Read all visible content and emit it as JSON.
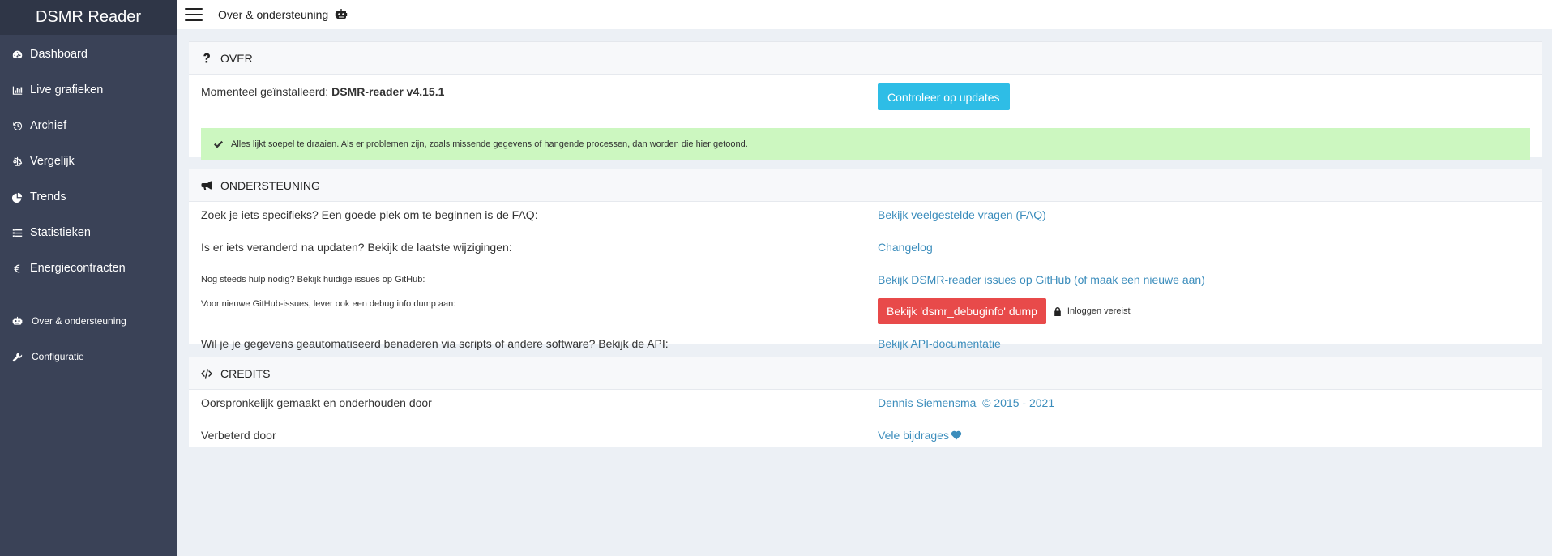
{
  "brand": "DSMR Reader",
  "sidebar": {
    "items": [
      {
        "label": "Dashboard",
        "icon": "tachometer-icon"
      },
      {
        "label": "Live grafieken",
        "icon": "bar-chart-icon"
      },
      {
        "label": "Archief",
        "icon": "history-icon"
      },
      {
        "label": "Vergelijk",
        "icon": "balance-scale-icon"
      },
      {
        "label": "Trends",
        "icon": "pie-chart-icon"
      },
      {
        "label": "Statistieken",
        "icon": "list-icon"
      },
      {
        "label": "Energiecontracten",
        "icon": "euro-icon"
      }
    ],
    "secondary": [
      {
        "label": "Over & ondersteuning",
        "icon": "robot-icon"
      },
      {
        "label": "Configuratie",
        "icon": "wrench-icon"
      }
    ]
  },
  "header": {
    "title": "Over & ondersteuning",
    "title_icon": "robot-icon"
  },
  "over": {
    "title": "OVER",
    "installed_label": "Momenteel geïnstalleerd: ",
    "installed_version": "DSMR-reader v4.15.1",
    "check_updates_button": "Controleer op updates",
    "alert_text": "Alles lijkt soepel te draaien. Als er problemen zijn, zoals missende gegevens of hangende processen, dan worden die hier getoond."
  },
  "support": {
    "title": "ONDERSTEUNING",
    "rows": [
      {
        "text": "Zoek je iets specifieks? Een goede plek om te beginnen is de FAQ:",
        "link": "Bekijk veelgestelde vragen (FAQ)"
      },
      {
        "text": "Is er iets veranderd na updaten? Bekijk de laatste wijzigingen:",
        "link": "Changelog"
      },
      {
        "text": "Nog steeds hulp nodig? Bekijk huidige issues op GitHub:",
        "link": "Bekijk DSMR-reader issues op GitHub (of maak een nieuwe aan)"
      },
      {
        "text": "Voor nieuwe GitHub-issues, lever ook een debug info dump aan:",
        "button": "Bekijk 'dsmr_debuginfo' dump",
        "lock_note": "Inloggen vereist"
      },
      {
        "text": "Wil je je gegevens geautomatiseerd benaderen via scripts of andere software? Bekijk de API:",
        "link": "Bekijk API-documentatie"
      }
    ]
  },
  "credits": {
    "title": "CREDITS",
    "rows": [
      {
        "text": "Oorspronkelijk gemaakt en onderhouden door",
        "link": "Dennis Siemensma",
        "extra": "  © 2015 - 2021"
      },
      {
        "text": "Verbeterd door",
        "link": "Vele bijdrages"
      }
    ]
  },
  "colors": {
    "sidebar": "#3a4257",
    "brand_bg": "#2f3647",
    "link": "#3c8dbc",
    "info_button": "#2ebde6",
    "danger_button": "#e84a4a",
    "success_alert": "#ccf7c0"
  }
}
